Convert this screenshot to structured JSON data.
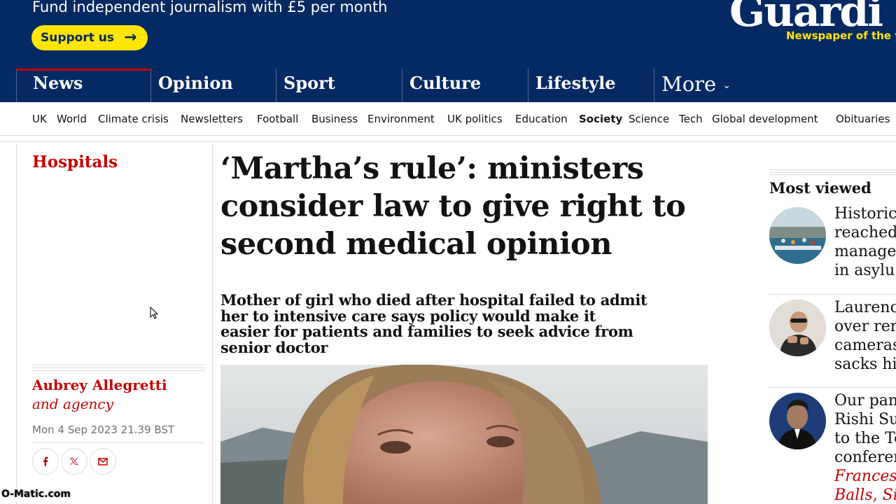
{
  "masthead": {
    "fund_text": "Fund independent journalism with £5 per month",
    "support_label": "Support us",
    "logo_text": "Guardi",
    "tagline": "Newspaper of the y",
    "background": "#052962",
    "support_color": "#ffe500"
  },
  "pillars": [
    {
      "label": "News"
    },
    {
      "label": "Opinion"
    },
    {
      "label": "Sport"
    },
    {
      "label": "Culture"
    },
    {
      "label": "Lifestyle"
    },
    {
      "label": "More"
    }
  ],
  "subnav": [
    "UK",
    "World",
    "Climate crisis",
    "Newsletters",
    "Football",
    "Business",
    "Environment",
    "UK politics",
    "Education",
    "Society",
    "Science",
    "Tech",
    "Global development",
    "Obituaries"
  ],
  "subnav_active": "Society",
  "article": {
    "section": "Hospitals",
    "headline": "‘Martha’s rule’: ministers consider law to give right to second medical opinion",
    "standfirst": "Mother of girl who died after hospital failed to admit her to intensive care says policy would make it easier for patients and families to seek advice from senior doctor",
    "author": "Aubrey Allegretti",
    "agency": "and agency",
    "date": "Mon 4 Sep 2023 21.39 BST",
    "accent_color": "#c70000"
  },
  "share_icons": [
    "facebook-icon",
    "twitter-icon",
    "email-icon"
  ],
  "most_viewed": {
    "title": "Most viewed",
    "items": [
      {
        "lines": [
          "Historic",
          "reached",
          "managem",
          "in asylu"
        ],
        "kicker": ""
      },
      {
        "lines": [
          "Laurence",
          "over rem",
          "cameras",
          "sacks hi"
        ],
        "kicker": ""
      },
      {
        "lines": [
          "Our pan",
          "Rishi Su",
          "to the To",
          "conferen"
        ],
        "kicker": "Frances",
        "kicker2": "Balls, Si"
      }
    ]
  },
  "watermark": "O-Matic.com"
}
